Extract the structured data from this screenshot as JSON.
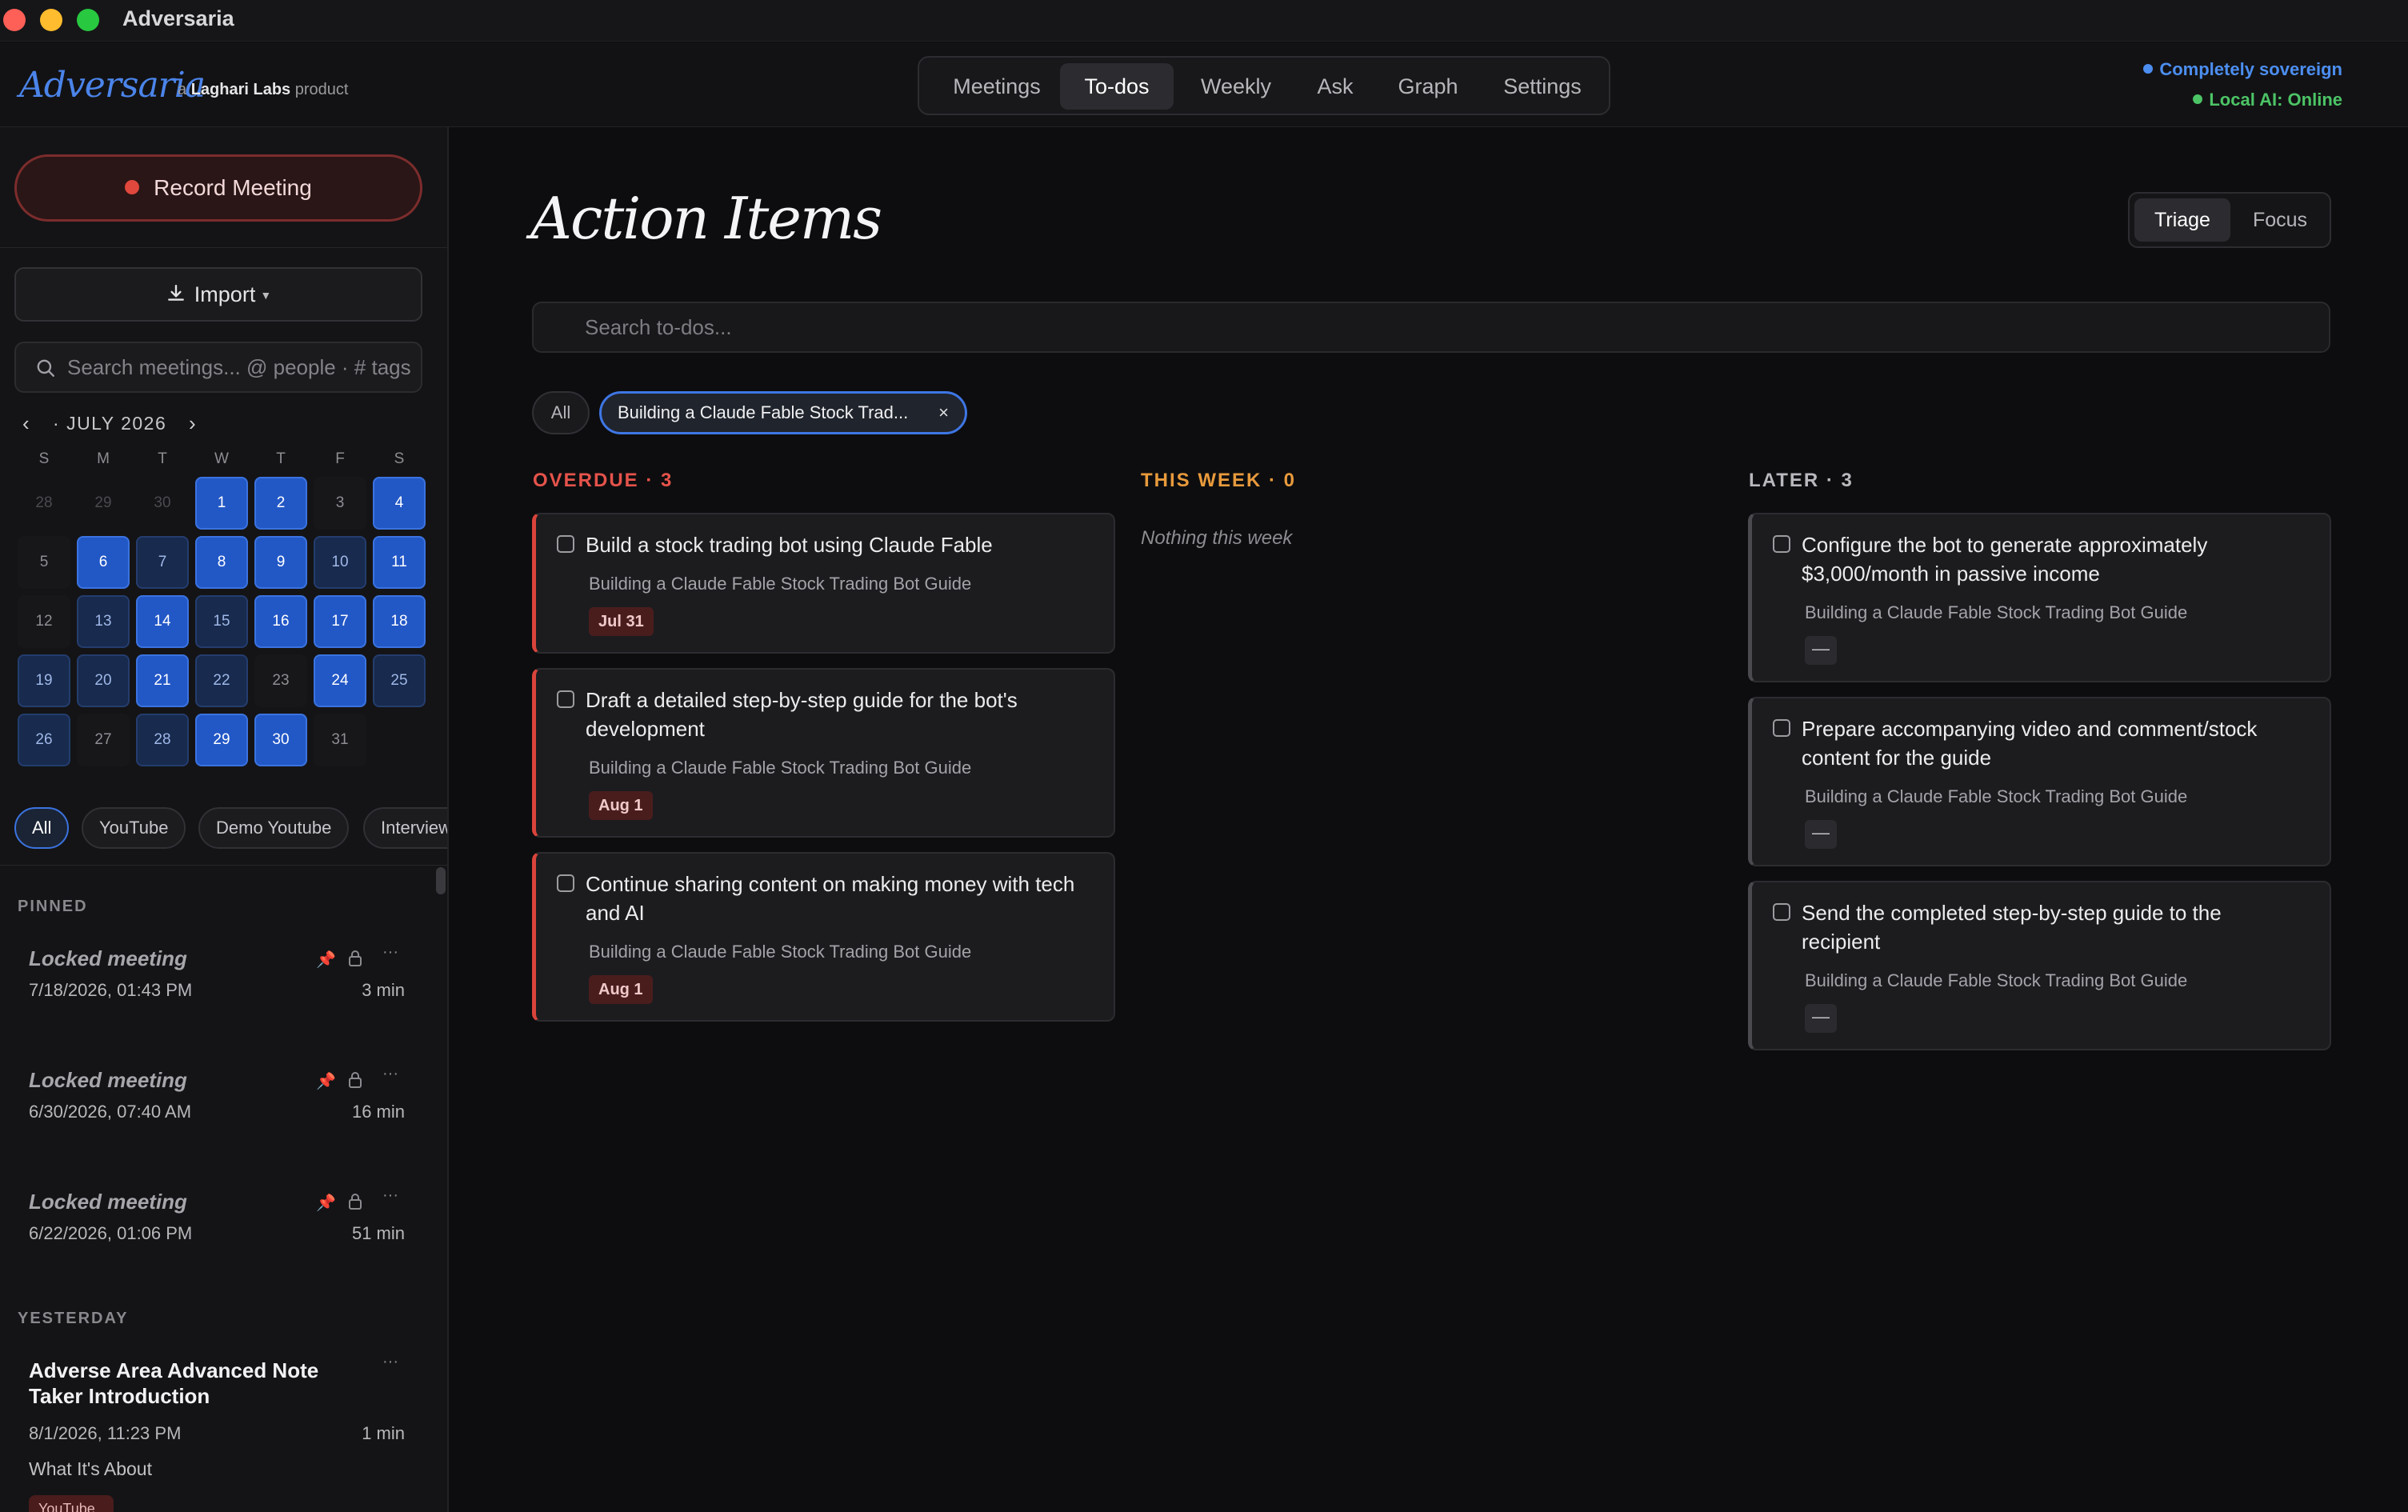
{
  "window": {
    "title": "Adversaria"
  },
  "header": {
    "brand": "Adversaria",
    "brand_sub_prefix": "a",
    "brand_sub_company": "Laghari Labs",
    "brand_sub_suffix": "product",
    "nav": [
      {
        "label": "Meetings",
        "active": false
      },
      {
        "label": "To-dos",
        "active": true
      },
      {
        "label": "Weekly",
        "active": false
      },
      {
        "label": "Ask",
        "active": false
      },
      {
        "label": "Graph",
        "active": false
      },
      {
        "label": "Settings",
        "active": false
      }
    ],
    "status_sovereign": "Completely sovereign",
    "status_ai": "Local AI: Online",
    "colors": {
      "accent": "#4b84ea",
      "sovereign": "#4c8ef0",
      "online": "#4cc466"
    }
  },
  "sidebar": {
    "record_label": "Record Meeting",
    "import_label": "Import",
    "search_placeholder": "Search meetings... @ people · # tags",
    "calendar": {
      "month_label": "JULY 2026",
      "dow": [
        "S",
        "M",
        "T",
        "W",
        "T",
        "F",
        "S"
      ],
      "days": [
        {
          "n": "28",
          "s": "muted"
        },
        {
          "n": "29",
          "s": "muted"
        },
        {
          "n": "30",
          "s": "muted"
        },
        {
          "n": "1",
          "s": "hi"
        },
        {
          "n": "2",
          "s": "hi"
        },
        {
          "n": "3",
          "s": "plain"
        },
        {
          "n": "4",
          "s": "hi"
        },
        {
          "n": "5",
          "s": "plain"
        },
        {
          "n": "6",
          "s": "hi"
        },
        {
          "n": "7",
          "s": "lo"
        },
        {
          "n": "8",
          "s": "hi"
        },
        {
          "n": "9",
          "s": "hi"
        },
        {
          "n": "10",
          "s": "lo"
        },
        {
          "n": "11",
          "s": "hi"
        },
        {
          "n": "12",
          "s": "plain"
        },
        {
          "n": "13",
          "s": "lo"
        },
        {
          "n": "14",
          "s": "hi"
        },
        {
          "n": "15",
          "s": "lo"
        },
        {
          "n": "16",
          "s": "hi"
        },
        {
          "n": "17",
          "s": "hi"
        },
        {
          "n": "18",
          "s": "hi"
        },
        {
          "n": "19",
          "s": "lo"
        },
        {
          "n": "20",
          "s": "lo"
        },
        {
          "n": "21",
          "s": "hi"
        },
        {
          "n": "22",
          "s": "lo"
        },
        {
          "n": "23",
          "s": "plain"
        },
        {
          "n": "24",
          "s": "hi"
        },
        {
          "n": "25",
          "s": "lo"
        },
        {
          "n": "26",
          "s": "lo"
        },
        {
          "n": "27",
          "s": "plain"
        },
        {
          "n": "28",
          "s": "lo"
        },
        {
          "n": "29",
          "s": "hi"
        },
        {
          "n": "30",
          "s": "hi"
        },
        {
          "n": "31",
          "s": "plain"
        }
      ]
    },
    "filter_chips": [
      "All",
      "YouTube",
      "Demo Youtube",
      "Interview"
    ],
    "pinned_label": "PINNED",
    "pinned": [
      {
        "title": "Locked meeting",
        "date": "7/18/2026, 01:43 PM",
        "duration": "3 min"
      },
      {
        "title": "Locked meeting",
        "date": "6/30/2026, 07:40 AM",
        "duration": "16 min"
      },
      {
        "title": "Locked meeting",
        "date": "6/22/2026, 01:06 PM",
        "duration": "51 min"
      }
    ],
    "yesterday_label": "YESTERDAY",
    "yesterday": {
      "title": "Adverse Area Advanced Note Taker Introduction",
      "date": "8/1/2026, 11:23 PM",
      "duration": "1 min",
      "summary": "What It's About",
      "tag": "YouTube"
    }
  },
  "main": {
    "title": "Action Items",
    "view_toggle": [
      "Triage",
      "Focus"
    ],
    "search_placeholder": "Search to-dos...",
    "filter_all": "All",
    "filter_project": "Building a Claude Fable Stock Trad...",
    "columns": {
      "overdue_label": "OVERDUE · 3",
      "this_week_label": "THIS WEEK · 0",
      "later_label": "LATER · 3",
      "empty_this_week": "Nothing this week"
    },
    "overdue": [
      {
        "title": "Build a stock trading bot using Claude Fable",
        "project": "Building a Claude Fable Stock Trading Bot Guide",
        "due": "Jul 31"
      },
      {
        "title": "Draft a detailed step-by-step guide for the bot's development",
        "project": "Building a Claude Fable Stock Trading Bot Guide",
        "due": "Aug 1"
      },
      {
        "title": "Continue sharing content on making money with tech and AI",
        "project": "Building a Claude Fable Stock Trading Bot Guide",
        "due": "Aug 1"
      }
    ],
    "later": [
      {
        "title": "Configure the bot to generate approximately $3,000/month in passive income",
        "project": "Building a Claude Fable Stock Trading Bot Guide",
        "due": "—"
      },
      {
        "title": "Prepare accompanying video and comment/stock content for the guide",
        "project": "Building a Claude Fable Stock Trading Bot Guide",
        "due": "—"
      },
      {
        "title": "Send the completed step-by-step guide to the recipient",
        "project": "Building a Claude Fable Stock Trading Bot Guide",
        "due": "—"
      }
    ]
  }
}
